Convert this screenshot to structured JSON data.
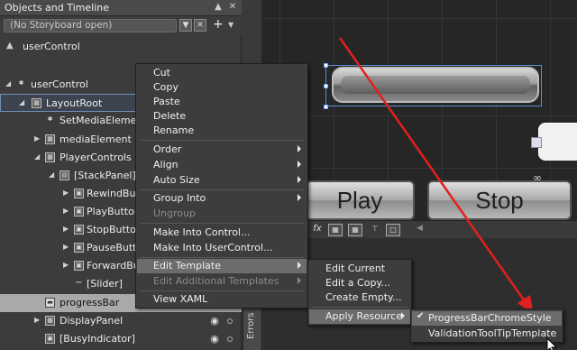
{
  "panel": {
    "title": "Objects and Timeline",
    "storyboard_placeholder": "(No Storyboard open)",
    "scope_label": "userControl"
  },
  "tree": {
    "items": [
      {
        "label": "userControl"
      },
      {
        "label": "LayoutRoot"
      },
      {
        "label": "SetMediaElement"
      },
      {
        "label": "mediaElement"
      },
      {
        "label": "PlayerControls"
      },
      {
        "label": "[StackPanel]"
      },
      {
        "label": "RewindButt"
      },
      {
        "label": "PlayButton"
      },
      {
        "label": "StopButton"
      },
      {
        "label": "PauseButto"
      },
      {
        "label": "ForwardBu"
      },
      {
        "label": "[Slider]"
      },
      {
        "label": "progressBar"
      },
      {
        "label": "DisplayPanel"
      },
      {
        "label": "[BusyIndicator]"
      }
    ]
  },
  "errors_tab": "Errors",
  "surface": {
    "play_label": "Play",
    "stop_label": "Stop"
  },
  "context_menu": {
    "items": [
      {
        "label": "Cut"
      },
      {
        "label": "Copy"
      },
      {
        "label": "Paste"
      },
      {
        "label": "Delete"
      },
      {
        "label": "Rename"
      },
      {
        "label": "Order"
      },
      {
        "label": "Align"
      },
      {
        "label": "Auto Size"
      },
      {
        "label": "Group Into"
      },
      {
        "label": "Ungroup"
      },
      {
        "label": "Make Into Control..."
      },
      {
        "label": "Make Into UserControl..."
      },
      {
        "label": "Edit Template"
      },
      {
        "label": "Edit Additional Templates"
      },
      {
        "label": "View XAML"
      }
    ]
  },
  "edit_template_menu": {
    "items": [
      {
        "label": "Edit Current"
      },
      {
        "label": "Edit a Copy..."
      },
      {
        "label": "Create Empty..."
      },
      {
        "label": "Apply Resource"
      }
    ]
  },
  "apply_resource_menu": {
    "items": [
      {
        "label": "ProgressBarChromeStyle",
        "checked": true
      },
      {
        "label": "ValidationToolTipTemplate",
        "checked": false
      }
    ]
  },
  "colors": {
    "annotation_arrow": "#e02020",
    "menu_highlight": "#6c6c6c"
  }
}
